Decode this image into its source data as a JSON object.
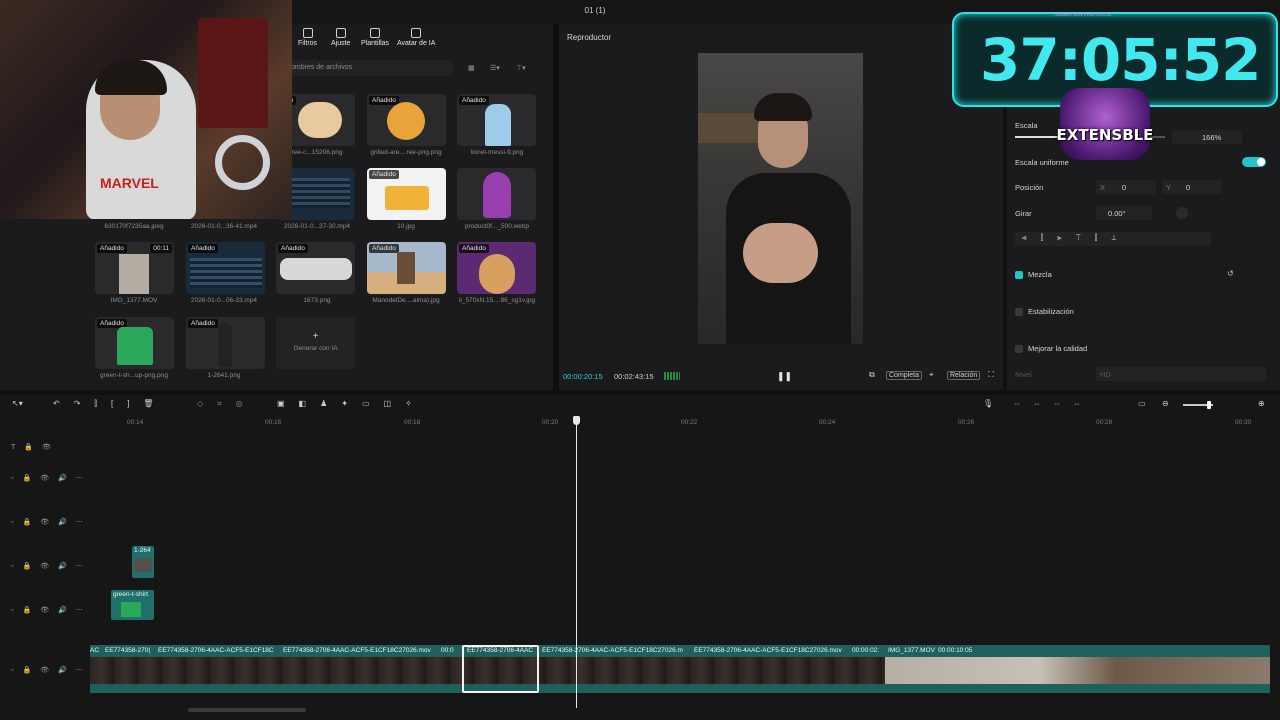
{
  "window": {
    "title": "01 (1)"
  },
  "media": {
    "tabs": [
      "Filtros",
      "Ajuste",
      "Plantillas",
      "Avatar de IA"
    ],
    "search_placeholder": "ombres de archivos",
    "items": [
      {
        "label": "ree-c...15206.png",
        "badge": "dido"
      },
      {
        "label": "grilled-are....ree-png.png",
        "badge": "Añadido"
      },
      {
        "label": "lionel-messi-9.png",
        "badge": "Añadido"
      },
      {
        "label": "630170f7235aa.jpeg",
        "badge": ""
      },
      {
        "label": "2026-01-0...36-41.mp4",
        "badge": ""
      },
      {
        "label": "2026-01-0...37-30.mp4",
        "badge": ""
      },
      {
        "label": "10.jpg",
        "badge": "Añadido"
      },
      {
        "label": "product0f..._500.webp",
        "badge": ""
      },
      {
        "label": "IMG_1377.MOV",
        "badge": "Añadido",
        "duration": "00:11"
      },
      {
        "label": "2026-01-0...06-33.mp4",
        "badge": "Añadido"
      },
      {
        "label": "1673.png",
        "badge": "Añadido"
      },
      {
        "label": "ManodelDe....alma).jpg",
        "badge": "Añadido"
      },
      {
        "label": "il_570xN.15....96_sg1v.jpg",
        "badge": "Añadido"
      },
      {
        "label": "green-t-sh...up-png.png",
        "badge": "Añadido"
      },
      {
        "label": "1-2641.png",
        "badge": "Añadido"
      }
    ],
    "generate_label": "Generar con IA"
  },
  "player": {
    "title": "Reproductor",
    "current_time": "00:00:20:15",
    "total_time": "00:02:43:15",
    "btn_full": "Completa",
    "btn_ratio": "Relación"
  },
  "properties": {
    "scale_label": "Escala",
    "scale_value": "166%",
    "uniform_scale_label": "Escala uniforme",
    "position_label": "Posición",
    "x_label": "X",
    "x_value": "0",
    "y_label": "Y",
    "y_value": "0",
    "rotate_label": "Girar",
    "rotate_value": "0.00°",
    "blend_label": "Mezcla",
    "stabilization_label": "Estabilización",
    "improve_quality_label": "Mejorar la calidad",
    "level_label": "Nivel",
    "level_value": "HD",
    "accent_color": "#22c4c4"
  },
  "overlay": {
    "timer": "37:05:52",
    "timer_sub": "SUBATHON PROTOCOL",
    "badge_text": "EXTENSBLE",
    "webcam_logo": "MARVEL"
  },
  "timeline": {
    "ruler": [
      "00:14",
      "00:16",
      "00:18",
      "00:20",
      "00:22",
      "00:24",
      "00:26",
      "00:28",
      "00:30"
    ],
    "clips": [
      "AC",
      "EE774358-270(",
      "EE774358-2706-4AAC-ACF5-E1CF18C",
      "EE774358-2706-4AAC-ACF5-E1CF18C27026.mov",
      "00:0",
      "EE774358-2706-4AAC",
      "EE774358-2706-4AAC-ACF5-E1CF18C27026.m",
      "EE774358-2706-4AAC-ACF5-E1CF18C27026.mov",
      "00:00:02:",
      "IMG_1377.MOV",
      "00:00:10:05"
    ],
    "small_clips": [
      "1-264",
      "green-t-shirt"
    ]
  }
}
